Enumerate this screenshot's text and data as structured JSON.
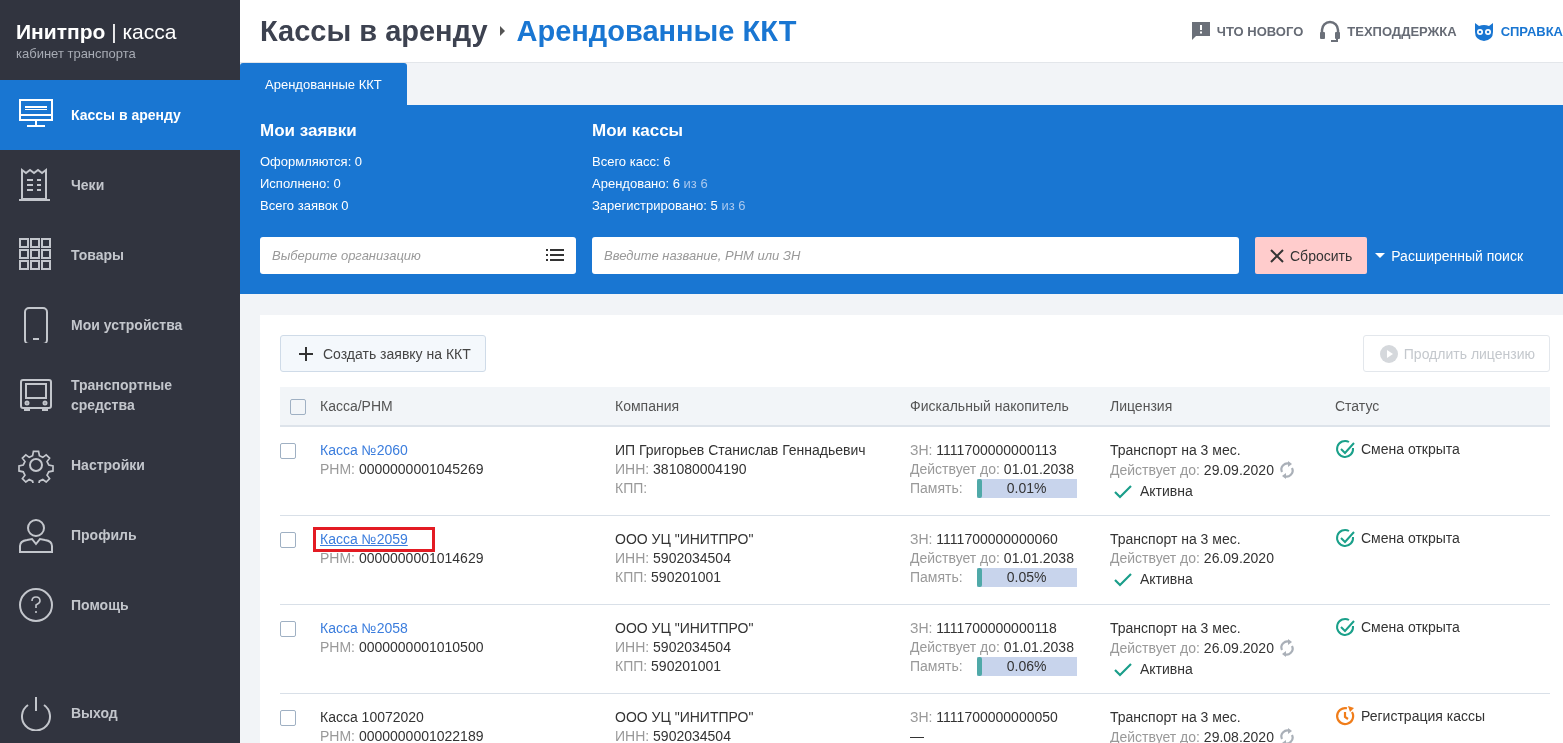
{
  "brand": {
    "name": "Инитпро",
    "separator": "|",
    "product": "касса",
    "subtitle": "кабинет транспорта"
  },
  "sidebar": {
    "items": [
      {
        "label": "Кассы в аренду",
        "kind": "monitor",
        "selected": true
      },
      {
        "label": "Чеки",
        "kind": "receipt",
        "selected": false
      },
      {
        "label": "Товары",
        "kind": "grid",
        "selected": false
      },
      {
        "label": "Мои устройства",
        "kind": "phone",
        "selected": false
      },
      {
        "label": "Транспортные средства",
        "kind": "bus",
        "selected": false
      },
      {
        "label": "Настройки",
        "kind": "gear",
        "selected": false
      },
      {
        "label": "Профиль",
        "kind": "person",
        "selected": false
      },
      {
        "label": "Помощь",
        "kind": "help",
        "selected": false
      }
    ],
    "exit": {
      "label": "Выход"
    }
  },
  "header": {
    "breadcrumb": [
      {
        "label": "Кассы в аренду"
      },
      {
        "label": "Арендованные ККТ"
      }
    ],
    "links": [
      {
        "label": "ЧТО НОВОГО",
        "kind": "message"
      },
      {
        "label": "ТЕХПОДДЕРЖКА",
        "kind": "headset"
      },
      {
        "label": "СПРАВКА",
        "kind": "owl"
      }
    ]
  },
  "tabs": [
    {
      "label": "Арендованные ККТ",
      "selected": true
    }
  ],
  "summary": [
    {
      "title": "Мои заявки",
      "lines": [
        {
          "label": "Оформляются:",
          "value": "0"
        },
        {
          "label": "Исполнено:",
          "value": "0"
        },
        {
          "label": "Всего заявок",
          "value": "0"
        }
      ]
    },
    {
      "title": "Мои кассы",
      "lines": [
        {
          "label": "Всего касс:",
          "value": "6"
        },
        {
          "label": "Арендовано:",
          "value": "6",
          "of": "из 6"
        },
        {
          "label": "Зарегистрировано:",
          "value": "5",
          "of": "из 6"
        }
      ]
    }
  ],
  "filters": {
    "organization": {
      "placeholder": "Выберите организацию"
    },
    "search": {
      "placeholder": "Введите название, РНМ или ЗН"
    },
    "reset": "Сбросить",
    "advanced": "Расширенный поиск"
  },
  "toolbar": {
    "create": "Создать заявку на ККТ",
    "extend": {
      "label": "Продлить лицензию",
      "disabled": true
    }
  },
  "table": {
    "all_checked": false,
    "columns": [
      "Касса/РНМ",
      "Компания",
      "Фискальный накопитель",
      "Лицензия",
      "Статус"
    ],
    "rows": [
      {
        "checked": false,
        "name": "Касса №2060",
        "kind": "link",
        "highlighted": false,
        "rnm": {
          "label": "РНМ:",
          "value": "0000000001045269"
        },
        "company": "ИП Григорьев Станислав Геннадьевич",
        "inn": {
          "label": "ИНН:",
          "value": "381080004190"
        },
        "kpp": {
          "label": "КПП:"
        },
        "fn": [
          {
            "label": "ЗН:",
            "value": "1111700000000113"
          },
          {
            "label": "Действует до:",
            "value": "01.01.2038"
          }
        ],
        "memory": {
          "label": "Память:",
          "reading": "0.01%",
          "level": 0.0001
        },
        "license": {
          "name": "Транспорт на 3 мес.",
          "valid_label": "Действует до:",
          "valid": "29.09.2020",
          "renew": true,
          "state": "Активна"
        },
        "status": {
          "kind": "open",
          "label": "Смена открыта"
        }
      },
      {
        "checked": false,
        "name": "Касса №2059",
        "kind": "link",
        "highlighted": true,
        "rnm": {
          "label": "РНМ:",
          "value": "0000000001014629"
        },
        "company": "ООО УЦ \"ИНИТПРО\"",
        "inn": {
          "label": "ИНН:",
          "value": "5902034504"
        },
        "kpp": {
          "label": "КПП:",
          "value": "590201001"
        },
        "fn": [
          {
            "label": "ЗН:",
            "value": "1111700000000060"
          },
          {
            "label": "Действует до:",
            "value": "01.01.2038"
          }
        ],
        "memory": {
          "label": "Память:",
          "reading": "0.05%",
          "level": 0.0005
        },
        "license": {
          "name": "Транспорт на 3 мес.",
          "valid_label": "Действует до:",
          "valid": "26.09.2020",
          "renew": false,
          "state": "Активна"
        },
        "status": {
          "kind": "open",
          "label": "Смена открыта"
        }
      },
      {
        "checked": false,
        "name": "Касса №2058",
        "kind": "link",
        "highlighted": false,
        "rnm": {
          "label": "РНМ:",
          "value": "0000000001010500"
        },
        "company": "ООО УЦ \"ИНИТПРО\"",
        "inn": {
          "label": "ИНН:",
          "value": "5902034504"
        },
        "kpp": {
          "label": "КПП:",
          "value": "590201001"
        },
        "fn": [
          {
            "label": "ЗН:",
            "value": "1111700000000118"
          },
          {
            "label": "Действует до:",
            "value": "01.01.2038"
          }
        ],
        "memory": {
          "label": "Память:",
          "reading": "0.06%",
          "level": 0.0006
        },
        "license": {
          "name": "Транспорт на 3 мес.",
          "valid_label": "Действует до:",
          "valid": "26.09.2020",
          "renew": true,
          "state": "Активна"
        },
        "status": {
          "kind": "open",
          "label": "Смена открыта"
        }
      },
      {
        "checked": false,
        "name": "Касса 10072020",
        "kind": "plain",
        "highlighted": false,
        "rnm": {
          "label": "РНМ:",
          "value": "0000000001022189"
        },
        "company": "ООО УЦ \"ИНИТПРО\"",
        "inn": {
          "label": "ИНН:",
          "value": "5902034504"
        },
        "fn": [
          {
            "label": "ЗН:",
            "value": "1111700000000050"
          }
        ],
        "fn_dash": "—",
        "license": {
          "name": "Транспорт на 3 мес.",
          "valid_label": "Действует до:",
          "valid": "29.08.2020",
          "renew": true
        },
        "status": {
          "kind": "registration",
          "label": "Регистрация кассы"
        }
      }
    ]
  }
}
